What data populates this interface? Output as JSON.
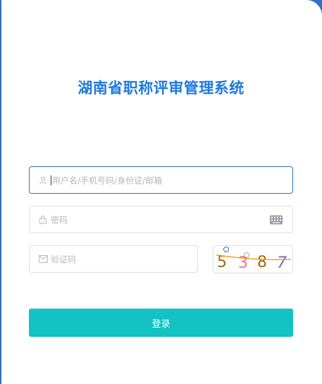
{
  "title": "湖南省职称评审管理系统",
  "form": {
    "username_placeholder": "用户名/手机号码/身份证/邮箱",
    "password_placeholder": "密码",
    "captcha_placeholder": "验证码",
    "captcha_chars": [
      "5",
      "3",
      "8",
      "7"
    ],
    "login_label": "登录"
  },
  "icons": {
    "username": "user-icon",
    "password": "lock-icon",
    "captcha": "mail-icon",
    "keyboard": "keyboard-icon"
  },
  "colors": {
    "background": "#2f6fcf",
    "title": "#1f78e0",
    "focus_border": "#2d6fbf",
    "button": "#13c2c2",
    "captcha_char_1": "#9a6b12",
    "captcha_char_2": "#ef6f8a",
    "captcha_char_3": "#9a6b12",
    "captcha_char_4": "#8d63b3",
    "captcha_line": "#f3a21b"
  }
}
